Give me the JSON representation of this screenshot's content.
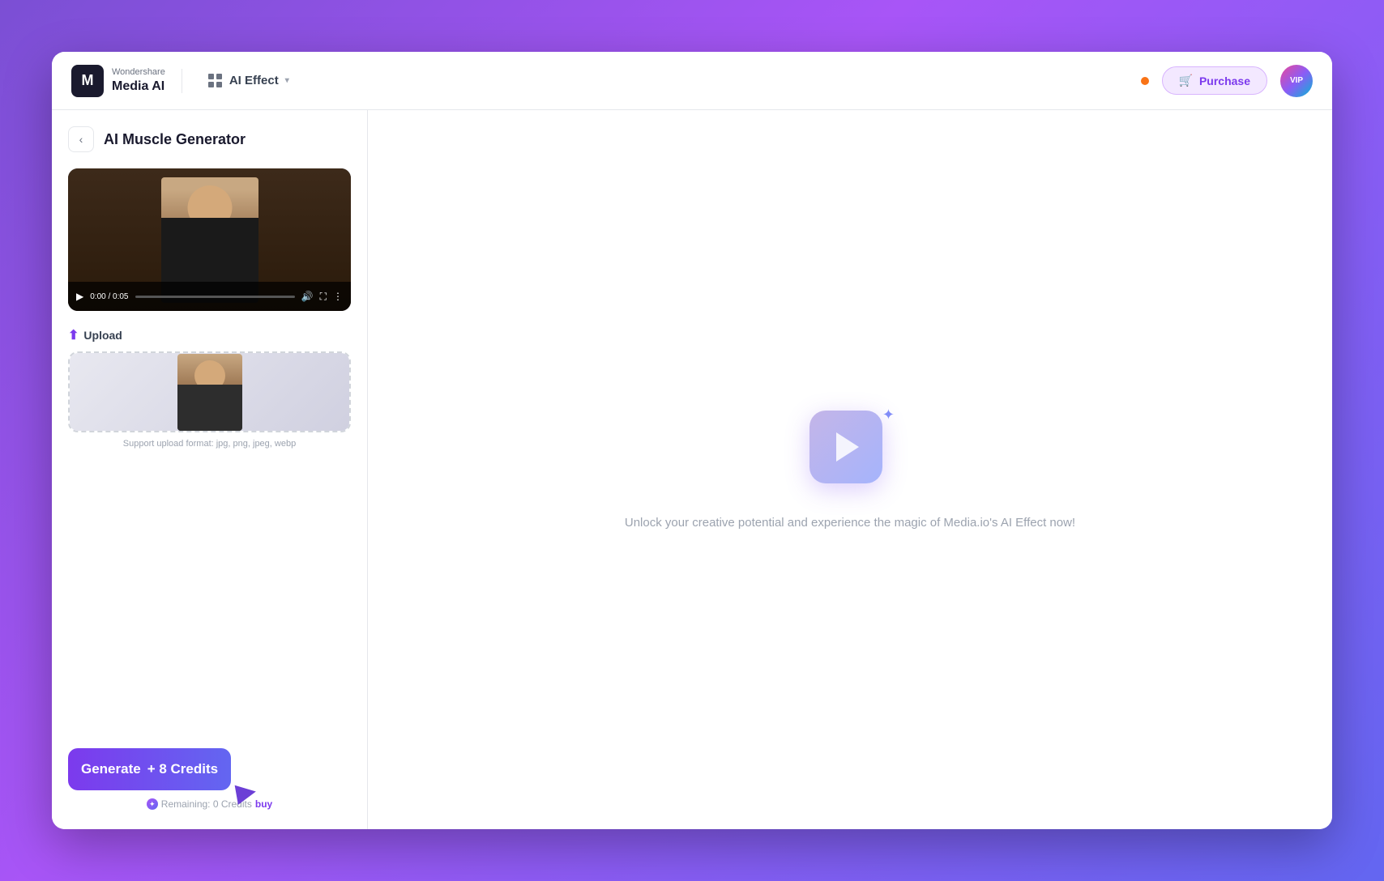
{
  "app": {
    "window_title": "Wondershare Media AI"
  },
  "header": {
    "logo_letter": "M",
    "brand_top": "Wondershare",
    "brand_bottom": "Media AI",
    "nav_label": "AI Effect",
    "nav_chevron": "▾",
    "status_color": "#f97316",
    "purchase_label": "Purchase",
    "vip_label": "VIP"
  },
  "sidebar": {
    "back_icon": "‹",
    "title": "AI Muscle Generator",
    "video": {
      "time_display": "0:00 / 0:05"
    },
    "upload": {
      "label": "Upload",
      "hint": "Support upload format: jpg, png, jpeg, webp"
    },
    "generate": {
      "label": "Generate",
      "credits_suffix": "+ 8 Credits",
      "remaining_text": "Remaining: 0 Credits",
      "buy_text": "buy"
    }
  },
  "main": {
    "tagline": "Unlock your creative potential and experience the magic of Media.io's AI Effect now!"
  }
}
